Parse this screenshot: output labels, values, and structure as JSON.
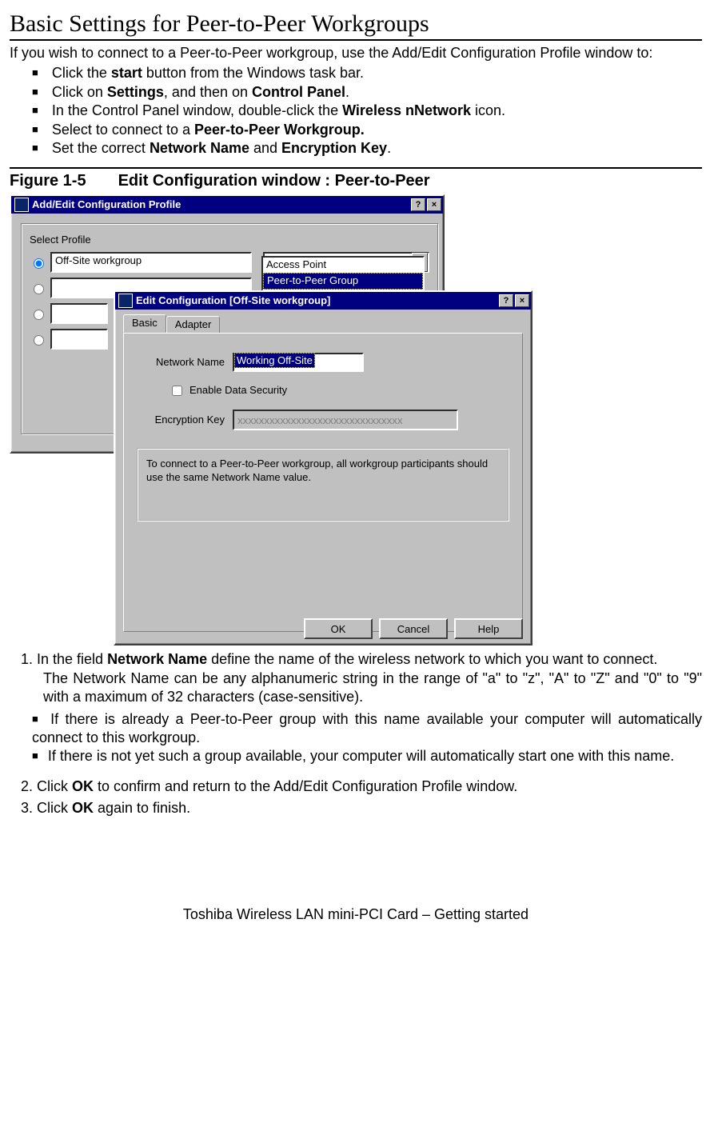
{
  "title": "Basic Settings for Peer-to-Peer Workgroups",
  "intro": "If you wish to connect to a Peer-to-Peer workgroup, use the Add/Edit Configuration Profile window to:",
  "bullets_top": {
    "b1": {
      "pre": "Click the ",
      "bold": "start",
      "post": " button from the Windows task bar."
    },
    "b2": {
      "pre": "Click on ",
      "b1": "Settings",
      "mid": ", and then on ",
      "b2": "Control Panel",
      "post": "."
    },
    "b3": {
      "pre": "In the Control Panel window, double-click the ",
      "bold": "Wireless nNetwork",
      "post": " icon."
    },
    "b4": {
      "pre": "Select to connect to a ",
      "bold": "Peer-to-Peer Workgroup."
    },
    "b5": {
      "pre": "Set the correct ",
      "b1": "Network Name",
      "mid": " and ",
      "b2": "Encryption Key",
      "post": "."
    }
  },
  "figure_caption_label": "Figure 1-5",
  "figure_caption_text": "Edit Configuration window : Peer-to-Peer",
  "dialog1": {
    "title": "Add/Edit Configuration Profile",
    "group_label": "Select Profile",
    "profile1": "Off-Site workgroup",
    "combo_selected": "Access Point",
    "list_opt1": "Access Point",
    "list_opt2": "Peer-to-Peer Group"
  },
  "dialog2": {
    "title": "Edit Configuration [Off-Site workgroup]",
    "tab_basic": "Basic",
    "tab_adapter": "Adapter",
    "label_network_name": "Network Name",
    "value_network_name": "Working Off-Site",
    "checkbox_label": "Enable Data Security",
    "label_enc_key": "Encryption Key",
    "value_enc_key": "xxxxxxxxxxxxxxxxxxxxxxxxxxxxxxx",
    "info_text": "To connect to a Peer-to-Peer workgroup, all workgroup participants should use the same Network Name value.",
    "btn_ok": "OK",
    "btn_cancel": "Cancel",
    "btn_help": "Help"
  },
  "step1": {
    "pre": "In the field ",
    "bold": "Network Name",
    "post": "  define the name of the wireless network to which you want to connect.",
    "line2": "The Network Name can be any alphanumeric string in the range of  \"a\" to \"z\", \"A\" to \"Z\" and \"0\" to \"9\" with a maximum of 32 characters (case-sensitive)."
  },
  "bullets_mid": {
    "b1": "If there is already a Peer-to-Peer group with this name available your computer will automatically connect to this workgroup.",
    "b2": "If there is not yet such a group available, your computer will automatically start one with this name."
  },
  "step2": {
    "pre": "Click ",
    "bold": "OK",
    "post": " to confirm and return to the Add/Edit Configuration Profile window."
  },
  "step3": {
    "pre": "Click ",
    "bold": "OK",
    "post": " again to finish."
  },
  "footer": "Toshiba Wireless LAN mini-PCI Card – Getting started"
}
